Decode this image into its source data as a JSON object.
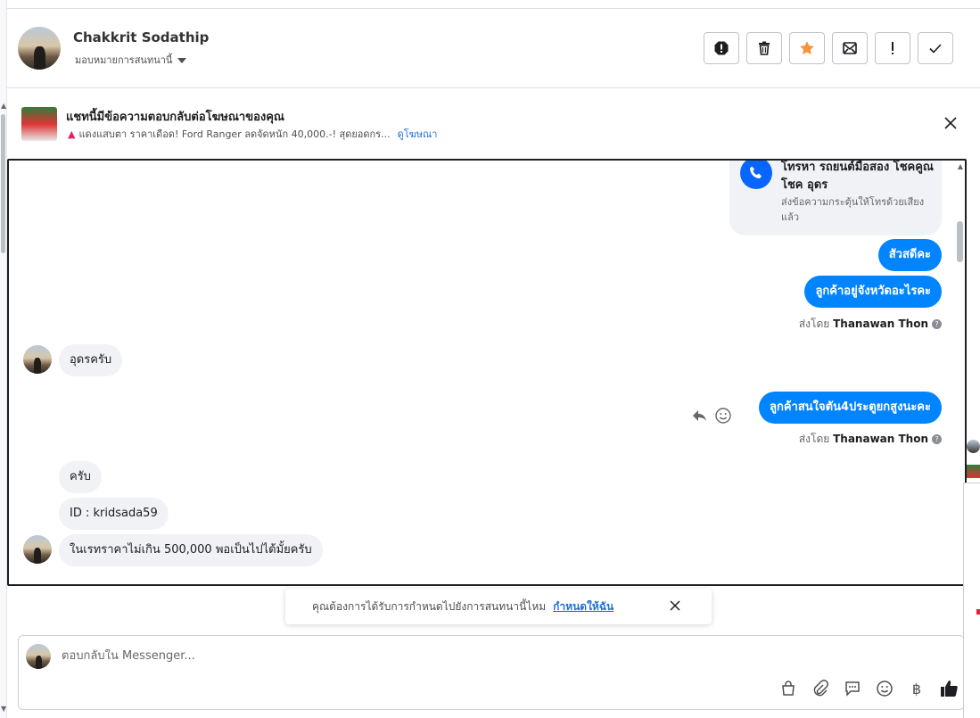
{
  "header": {
    "contact_name": "Chakkrit Sodathip",
    "assign_label": "มอบหมายการสนทนานี้",
    "actions": [
      "alert-icon",
      "trash-icon",
      "star-icon",
      "mark-unread-icon",
      "exclamation-icon",
      "check-icon"
    ]
  },
  "ad": {
    "title": "แชทนี้มีข้อความตอบกลับต่อโฆษณาของคุณ",
    "subtitle": "แดงแสบตา ราคาเดือด! Ford Ranger ลดจัดหนัก 40,000.-! สุดยอดกร...",
    "link": "ดูโฆษณา"
  },
  "call_card": {
    "title": "โทรหา รถยนต์มือสอง โชคคูณโชค อุดร",
    "subtitle": "ส่งข้อความกระตุ้นให้โทรด้วยเสียงแล้ว"
  },
  "messages": [
    {
      "text": "สัวสดีคะ",
      "side": "out"
    },
    {
      "text": "ลูกค้าอยู่จังหวัดอะไรคะ",
      "side": "out"
    },
    {
      "text": "อุดรครับ",
      "side": "in"
    },
    {
      "text": "ลูกค้าสนใจตัน4ประตูยกสูงนะคะ",
      "side": "out"
    },
    {
      "text": "ครับ",
      "side": "in"
    },
    {
      "text": "ID : kridsada59",
      "side": "in"
    },
    {
      "text": "ในเรทราคาไม่เกิน 500,000 พอเป็นไปได้มั้ยครับ",
      "side": "in"
    }
  ],
  "sent_by": {
    "prefix": "ส่งโดย",
    "name": "Thanawan Thon"
  },
  "notice": {
    "text": "คุณต้องการได้รับการกำหนดไปยังการสนทนานี้ไหม",
    "link": "กำหนดให้ฉัน"
  },
  "composer": {
    "placeholder": "ตอบกลับใน Messenger...",
    "tools": [
      "shopping-bag-icon",
      "paperclip-icon",
      "saved-reply-icon",
      "emoji-icon",
      "baht-icon",
      "thumbs-up-icon"
    ]
  },
  "colors": {
    "accent": "#0084ff",
    "link": "#216fdb",
    "star": "#f7923b"
  }
}
